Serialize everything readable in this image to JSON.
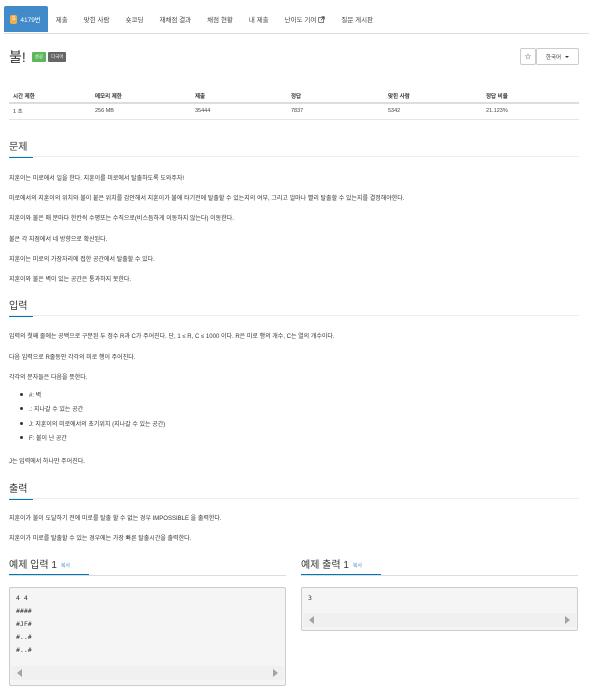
{
  "nav": {
    "tabs": [
      {
        "label": "4179번",
        "badge": "S"
      },
      {
        "label": "제출"
      },
      {
        "label": "맞힌 사람"
      },
      {
        "label": "숏코딩"
      },
      {
        "label": "재채점 결과"
      },
      {
        "label": "채점 현황"
      },
      {
        "label": "내 제출"
      },
      {
        "label": "난이도 기여"
      },
      {
        "label": "질문 게시판"
      }
    ]
  },
  "problem": {
    "title": "불!",
    "labels": [
      "성공",
      "다국어"
    ],
    "star": "☆",
    "language": "한국어"
  },
  "stats": {
    "headers": [
      "시간 제한",
      "메모리 제한",
      "제출",
      "정답",
      "맞힌 사람",
      "정답 비율"
    ],
    "values": [
      "1 초",
      "256 MB",
      "35444",
      "7837",
      "5342",
      "21.123%"
    ]
  },
  "sections": {
    "description": {
      "heading": "문제",
      "paragraphs": [
        "지훈이는 미로에서 일을 한다. 지훈이를 미로에서 탈출하도록 도와주자!",
        "미로에서의 지훈이의 위치와 불이 붙은 위치를 감안해서 지훈이가 불에 타기전에 탈출할 수 있는지의 여부, 그리고 얼마나 빨리 탈출할 수 있는지를 결정해야한다.",
        "지훈이와 불은 매 분마다 한칸씩 수평또는 수직으로(비스듬하게 이동하지 않는다) 이동한다.",
        "불은 각 지점에서 네 방향으로 확산된다.",
        "지훈이는 미로의 가장자리에 접한 공간에서 탈출할 수 있다.",
        "지훈이와 불은 벽이 있는 공간은 통과하지 못한다."
      ]
    },
    "input": {
      "heading": "입력",
      "paragraphs": [
        "입력의 첫째 줄에는 공백으로 구분된 두 정수 R과 C가 주어진다. 단, 1 ≤ R, C ≤ 1000 이다. R은 미로 행의 개수, C는 열의 개수이다.",
        "다음 입력으로 R줄동안 각각의 미로 행이 주어진다.",
        "각각의 문자들은 다음을 뜻한다."
      ],
      "bullets": [
        "#: 벽",
        ".: 지나갈 수 있는 공간",
        "J: 지훈이의 미로에서의 초기위치 (지나갈 수 있는 공간)",
        "F: 불이 난 공간"
      ],
      "footer": "J는 입력에서 하나만 주어진다."
    },
    "output": {
      "heading": "출력",
      "paragraphs": [
        "지훈이가 불이 도달하기 전에 미로를 탈출 할 수 없는 경우 IMPOSSIBLE 을 출력한다.",
        "지훈이가 미로를 탈출할 수 있는 경우에는 가장 빠른 탈출시간을 출력한다."
      ]
    }
  },
  "examples": {
    "input": {
      "heading": "예제 입력 1",
      "copy_label": "복사",
      "lines": [
        "4 4",
        "####",
        "#JF#",
        "#..#",
        "#..#"
      ]
    },
    "output": {
      "heading": "예제 출력 1",
      "copy_label": "복사",
      "lines": [
        "3"
      ]
    }
  }
}
